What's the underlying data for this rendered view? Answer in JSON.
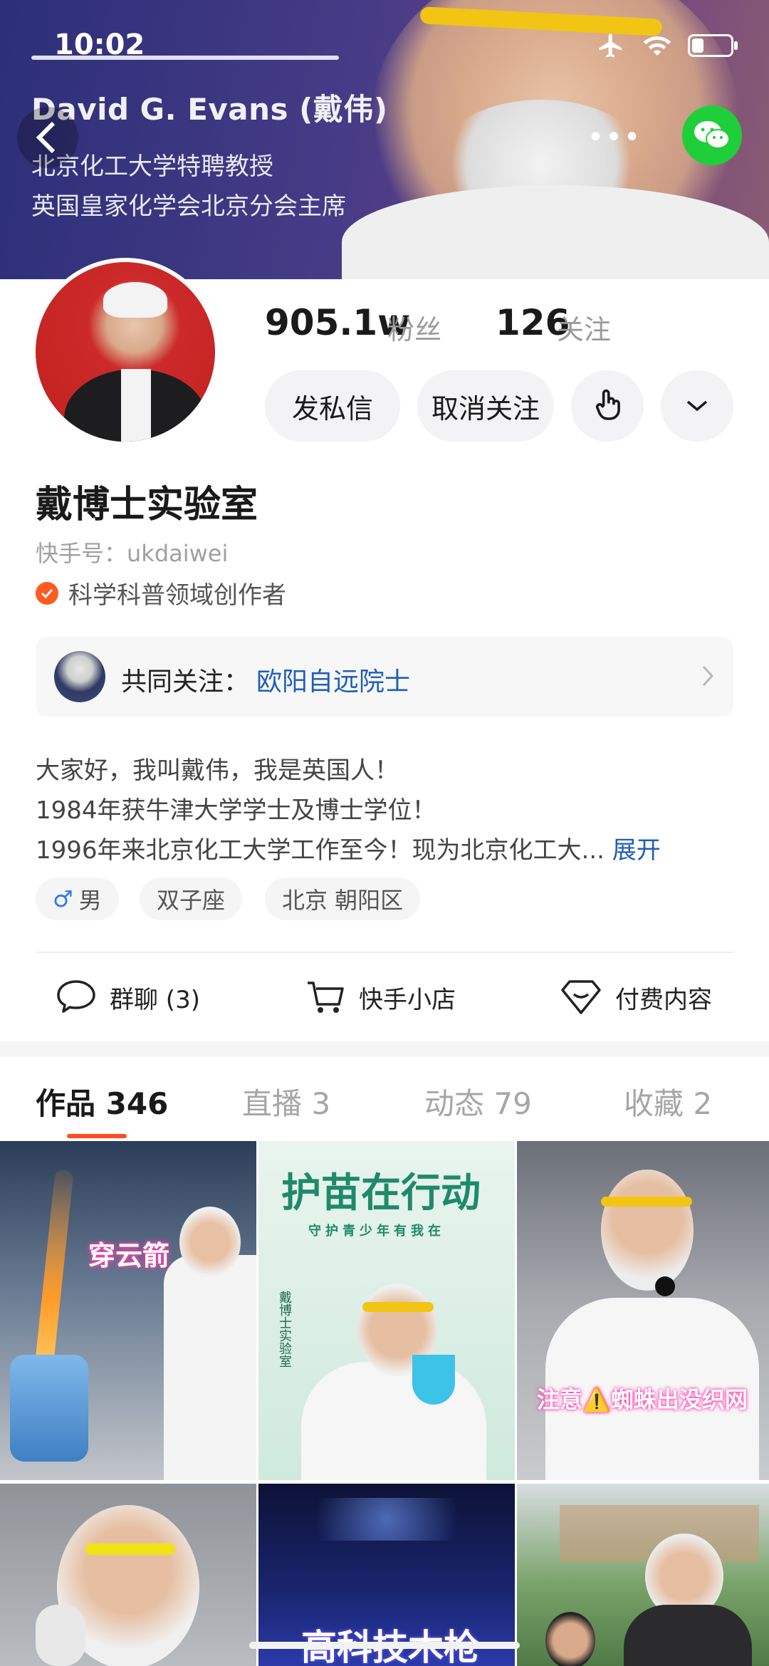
{
  "status_bar": {
    "time": "10:02"
  },
  "banner": {
    "name": "David G. Evans (戴伟)",
    "line1": "北京化工大学特聘教授",
    "line2": "英国皇家化学会北京分会主席"
  },
  "profile": {
    "followers_count": "905.1w",
    "followers_label": "粉丝",
    "following_count": "126",
    "following_label": "关注",
    "buttons": {
      "message": "发私信",
      "unfollow": "取消关注"
    },
    "name": "戴博士实验室",
    "kuaishou_id": "快手号：ukdaiwei",
    "creator_label": "科学科普领域创作者"
  },
  "mutual": {
    "label": "共同关注：",
    "name": "欧阳自远院士"
  },
  "bio": {
    "line1": "大家好，我叫戴伟，我是英国人！",
    "line2": "1984年获牛津大学学士及博士学位！",
    "line3": "1996年来北京化工大学工作至今！现为北京化工大...",
    "expand": "展开"
  },
  "tags": {
    "gender": "男",
    "zodiac": "双子座",
    "location": "北京 朝阳区"
  },
  "actions": {
    "group_chat": "群聊 (3)",
    "shop": "快手小店",
    "paid": "付费内容"
  },
  "tabs": [
    {
      "label": "作品 346"
    },
    {
      "label": "直播 3"
    },
    {
      "label": "动态 79"
    },
    {
      "label": "收藏 2"
    }
  ],
  "videos": {
    "v1_caption": "穿云箭",
    "v2_title": "护苗在行动",
    "v2_sub": "守护青少年有我在",
    "v2_vertical": "戴博士实验室",
    "v3_caption": "注意⚠️蜘蛛出没织网",
    "v5_caption": "高科技木枪"
  },
  "colors": {
    "accent": "#ff4d1f",
    "link": "#1f5fb6",
    "wechat": "#1fcf3a"
  }
}
